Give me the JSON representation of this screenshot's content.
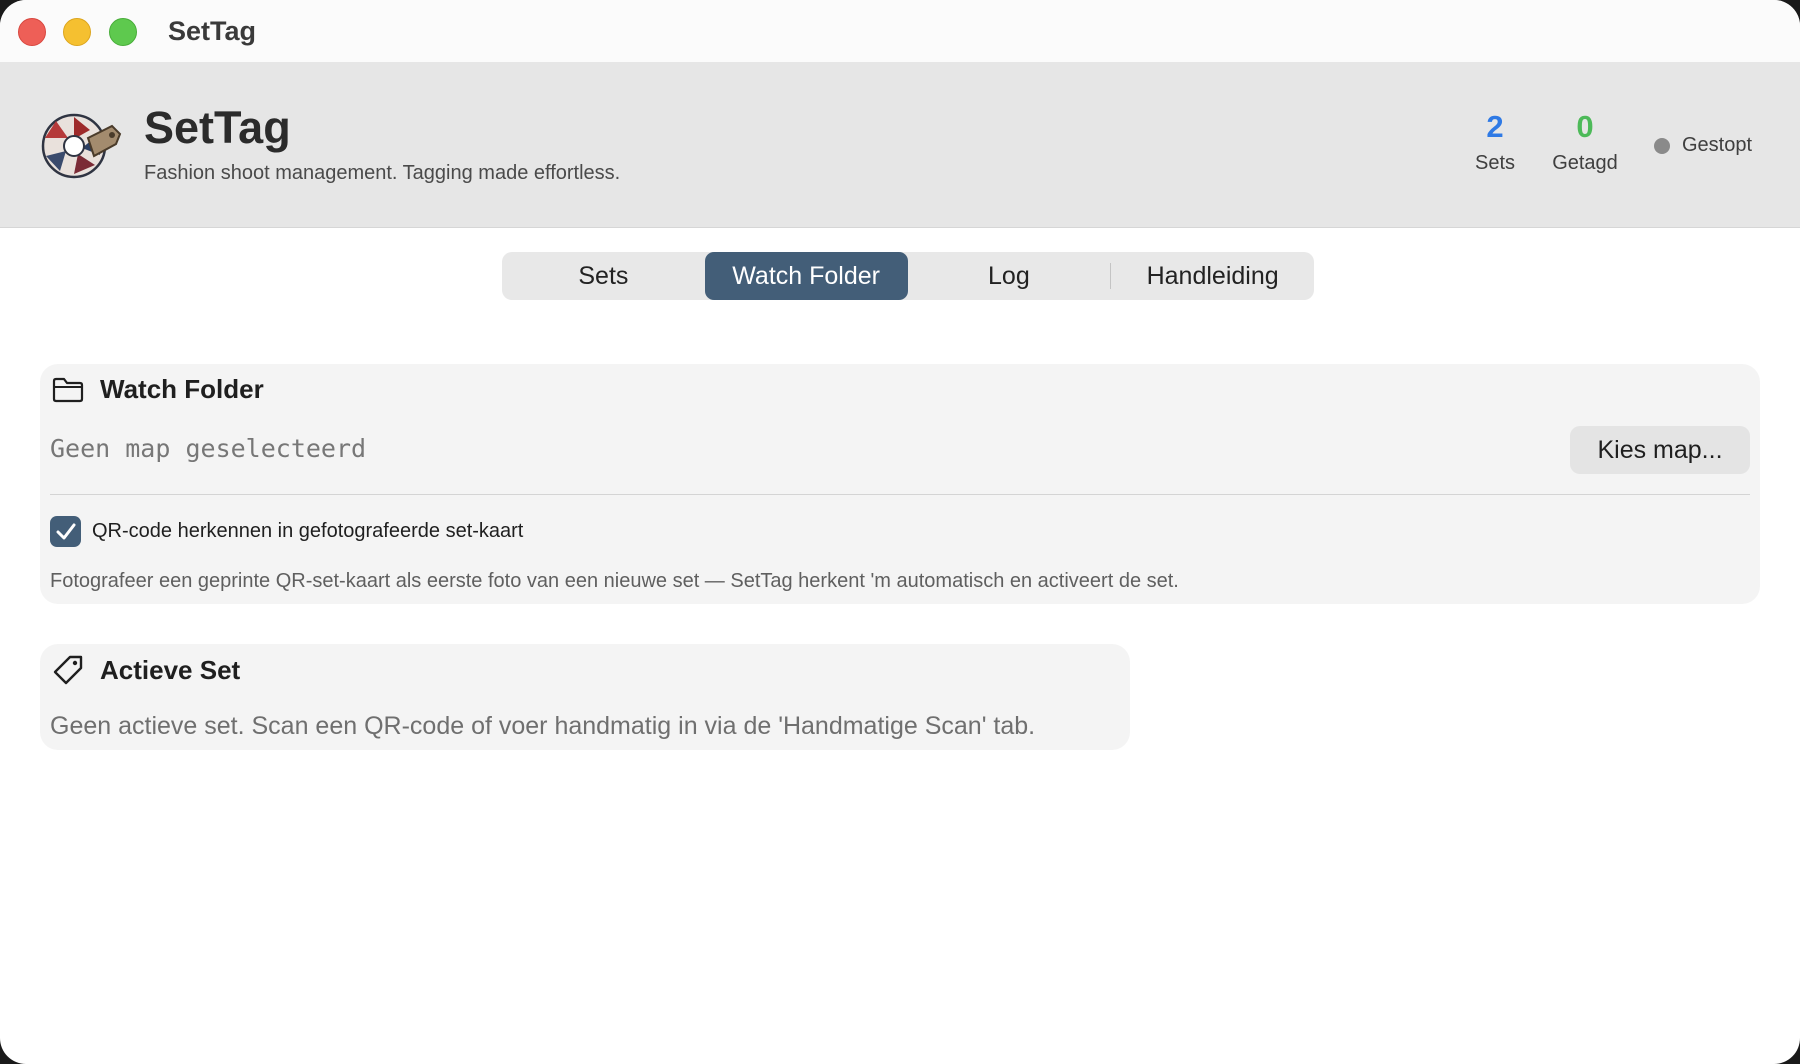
{
  "window": {
    "title": "SetTag",
    "controls": [
      "close",
      "minimize",
      "maximize"
    ]
  },
  "header": {
    "app_name": "SetTag",
    "tagline": "Fashion shoot management. Tagging made effortless.",
    "logo_icon": "camera-aperture-tag-logo",
    "stats": [
      {
        "value": "2",
        "label": "Sets",
        "color": "#2f7ae5"
      },
      {
        "value": "0",
        "label": "Getagd",
        "color": "#4dba59"
      }
    ],
    "status": {
      "label": "Gestopt",
      "color": "#8a8a8a"
    }
  },
  "tabs": [
    {
      "label": "Sets",
      "active": false
    },
    {
      "label": "Watch Folder",
      "active": true
    },
    {
      "label": "Log",
      "active": false
    },
    {
      "label": "Handleiding",
      "active": false
    }
  ],
  "watch_folder": {
    "title": "Watch Folder",
    "icon": "folder-icon",
    "path_text": "Geen map geselecteerd",
    "choose_button": "Kies map...",
    "qr_checkbox": {
      "label": "QR-code herkennen in gefotografeerde set-kaart",
      "checked": true
    },
    "hint": "Fotografeer een geprinte QR-set-kaart als eerste foto van een nieuwe set — SetTag herkent 'm automatisch en activeert de set."
  },
  "active_set": {
    "title": "Actieve Set",
    "icon": "tag-icon",
    "text": "Geen actieve set. Scan een QR-code of voer handmatig in via de 'Handmatige Scan' tab."
  },
  "colors": {
    "accent": "#435e78",
    "header_bg": "#e6e6e6",
    "card_bg": "#f4f4f4"
  }
}
